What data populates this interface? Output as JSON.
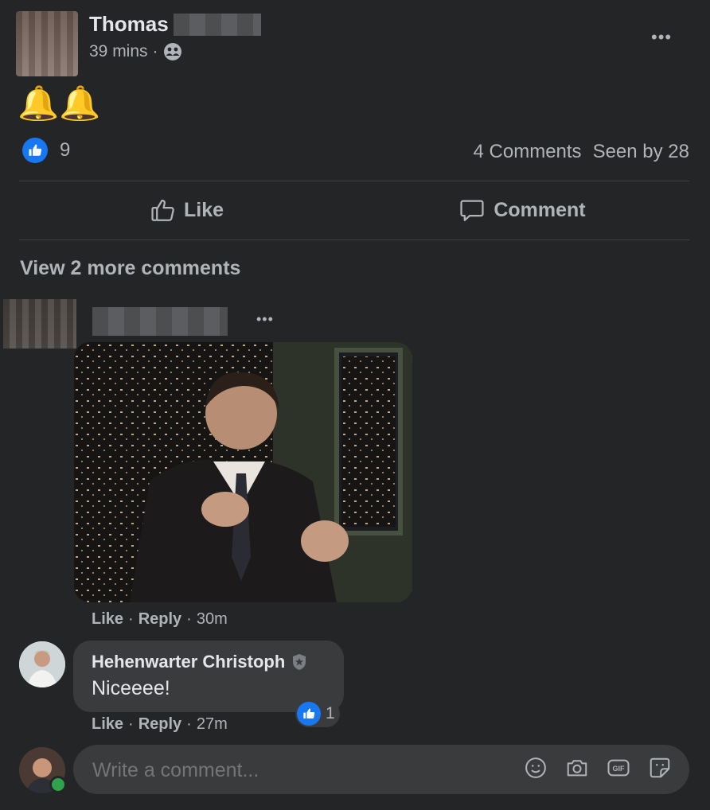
{
  "post": {
    "author": "Thomas",
    "time": "39 mins",
    "audience_icon": "friends-icon",
    "content": "🔔🔔",
    "reactions_count": "9",
    "comments_count": "4 Comments",
    "seen_by": "Seen by 28"
  },
  "actions": {
    "like_label": "Like",
    "comment_label": "Comment"
  },
  "view_more": "View 2 more comments",
  "comments": [
    {
      "author": "",
      "gif_description": "",
      "like": "Like",
      "reply": "Reply",
      "time": "30m"
    },
    {
      "author": "Hehenwarter Christoph",
      "text": "Niceeee!",
      "like": "Like",
      "reply": "Reply",
      "time": "27m",
      "reactions": "1"
    }
  ],
  "composer": {
    "placeholder": "Write a comment..."
  },
  "colors": {
    "background": "#242526",
    "bubble": "#3a3b3c",
    "like_blue": "#1877f2",
    "online_green": "#31a24c"
  }
}
